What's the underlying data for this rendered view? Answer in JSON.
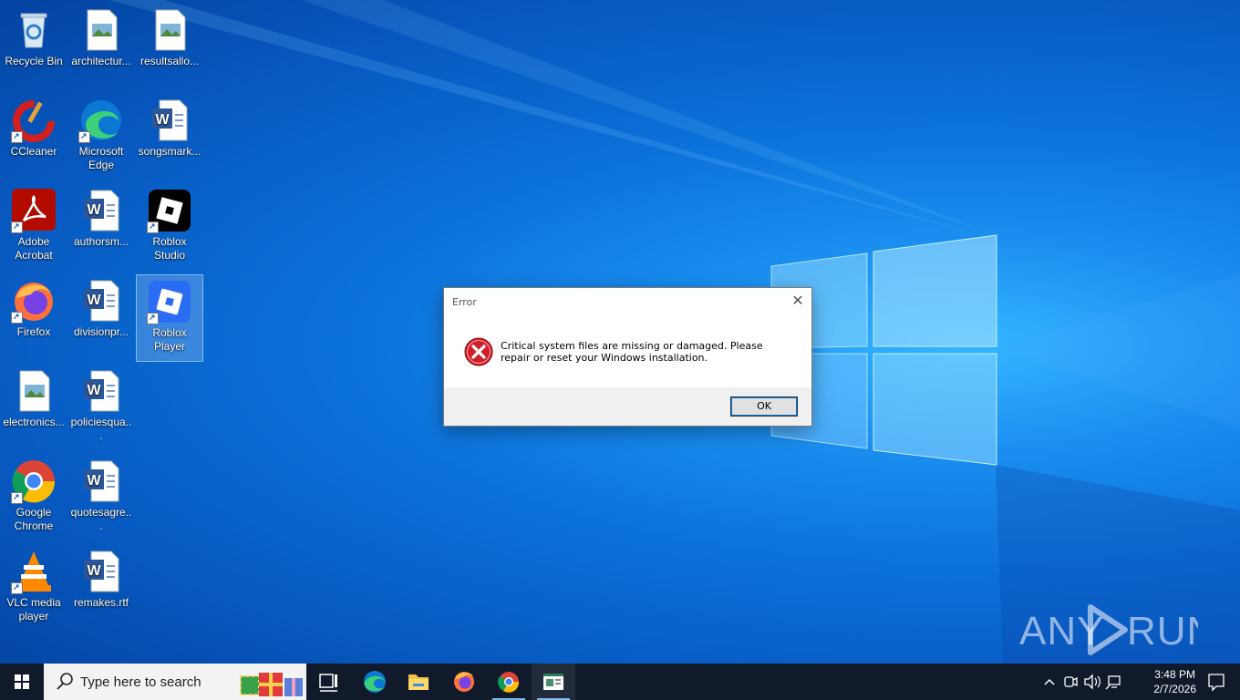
{
  "desktop": {
    "icons": [
      {
        "label": "Recycle Bin",
        "icon": "recycle-bin-icon"
      },
      {
        "label": "architectur...",
        "icon": "image-file-icon"
      },
      {
        "label": "resultsallo...",
        "icon": "image-file-icon"
      },
      {
        "label": "CCleaner",
        "icon": "ccleaner-icon"
      },
      {
        "label": "Microsoft Edge",
        "icon": "edge-icon"
      },
      {
        "label": "songsmark...",
        "icon": "word-document-icon"
      },
      {
        "label": "Adobe Acrobat",
        "icon": "acrobat-icon"
      },
      {
        "label": "authorsm...",
        "icon": "word-document-icon"
      },
      {
        "label": "Roblox Studio",
        "icon": "roblox-studio-icon"
      },
      {
        "label": "Firefox",
        "icon": "firefox-icon"
      },
      {
        "label": "divisionpr...",
        "icon": "word-document-icon"
      },
      {
        "label": "Roblox Player",
        "icon": "roblox-player-icon"
      },
      {
        "label": "electronics...",
        "icon": "image-file-icon"
      },
      {
        "label": "policiesqua...",
        "icon": "word-document-icon"
      },
      {
        "label": "Google Chrome",
        "icon": "chrome-icon"
      },
      {
        "label": "quotesagre...",
        "icon": "word-document-icon"
      },
      {
        "label": "VLC media player",
        "icon": "vlc-icon"
      },
      {
        "label": "remakes.rtf",
        "icon": "word-document-icon"
      }
    ]
  },
  "dialog": {
    "title": "Error",
    "message": "Critical system files are missing or damaged. Please repair or reset your Windows installation.",
    "ok_label": "OK",
    "close_glyph": "✕"
  },
  "watermark": {
    "text": "ANY RUN"
  },
  "taskbar": {
    "search_placeholder": "Type here to search",
    "pinned": [
      "task-view",
      "edge",
      "file-explorer",
      "firefox",
      "chrome",
      "notepad-window"
    ],
    "clock": {
      "time": "3:48 PM",
      "date": "2/7/2026"
    }
  },
  "colors": {
    "accent": "#0078d7",
    "taskbar": "#101a2a",
    "error_red": "#d11f2a"
  }
}
